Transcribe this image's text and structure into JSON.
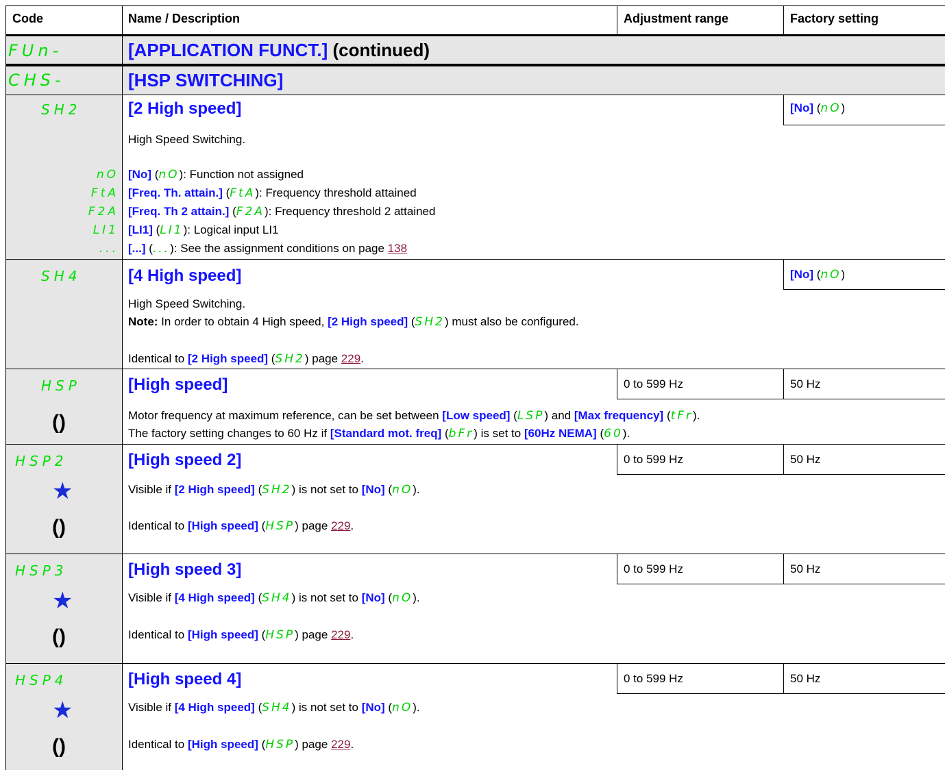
{
  "headers": {
    "code": "Code",
    "name": "Name / Description",
    "range": "Adjustment range",
    "factory": "Factory setting"
  },
  "fun": {
    "code": "FUn-",
    "title": "[APPLICATION FUNCT.]",
    "suffix": " (continued)"
  },
  "chs": {
    "code": "CHS-",
    "title": "[HSP SWITCHING]"
  },
  "sh2": {
    "code": "SH2",
    "title": "[2 High speed]",
    "factory_b": "[No]",
    "factory_g": "nO",
    "desc": "High Speed Switching.",
    "options": [
      {
        "code": "nO",
        "b": "[No]",
        "g": "nO",
        "t": ": Function not assigned"
      },
      {
        "code": "FtA",
        "b": "[Freq. Th. attain.]",
        "g": "FtA",
        "t": ": Frequency threshold attained"
      },
      {
        "code": "F2A",
        "b": "[Freq. Th 2 attain.]",
        "g": "F2A",
        "t": ": Frequency threshold 2 attained"
      },
      {
        "code": "LI1",
        "b": "[LI1]",
        "g": "LI1",
        "t": ": Logical input LI1"
      },
      {
        "code": "...",
        "b": "[...]",
        "g": "...",
        "t": ": See the assignment conditions on page ",
        "link": "138"
      }
    ]
  },
  "sh4": {
    "code": "SH4",
    "title": "[4 High speed]",
    "factory_b": "[No]",
    "factory_g": "nO",
    "desc": "High Speed Switching.",
    "note_label": "Note:",
    "note_a": " In order to obtain 4 High speed, ",
    "note_b": "[2 High speed]",
    "note_g": "SH2",
    "note_c": " must also be configured.",
    "ident_a": "Identical to ",
    "ident_b": "[2 High speed]",
    "ident_g": "SH2",
    "ident_c": " page ",
    "ident_link": "229",
    "ident_d": "."
  },
  "hsp": {
    "code": "HSP",
    "title": "[High speed]",
    "range": "0 to 599 Hz",
    "factory": "50 Hz",
    "l1_a": "Motor frequency at maximum reference, can be set between ",
    "l1_b": "[Low speed]",
    "l1_g": "LSP",
    "l1_c": " and ",
    "l1_d": "[Max frequency]",
    "l1_g2": "tFr",
    "l1_e": ".",
    "l2_a": "The factory setting changes to 60 Hz if ",
    "l2_b": "[Standard mot. freq]",
    "l2_g": "bFr",
    "l2_c": " is set to ",
    "l2_d": "[60Hz NEMA]",
    "l2_g2": "60",
    "l2_e": "."
  },
  "hsp2": {
    "code": "HSP2",
    "title": "[High speed 2]",
    "range": "0 to 599 Hz",
    "factory": "50 Hz",
    "v_a": "Visible if ",
    "v_b": "[2 High speed]",
    "v_g": "SH2",
    "v_c": " is not set to ",
    "v_d": "[No]",
    "v_g2": "nO",
    "v_e": ".",
    "i_a": "Identical to ",
    "i_b": "[High speed]",
    "i_g": "HSP",
    "i_c": " page ",
    "i_link": "229",
    "i_d": "."
  },
  "hsp3": {
    "code": "HSP3",
    "title": "[High speed 3]",
    "range": "0 to 599 Hz",
    "factory": "50 Hz",
    "v_a": "Visible if ",
    "v_b": "[4 High speed]",
    "v_g": "SH4",
    "v_c": " is not set to ",
    "v_d": "[No]",
    "v_g2": "nO",
    "v_e": ".",
    "i_a": "Identical to ",
    "i_b": "[High speed]",
    "i_g": "HSP",
    "i_c": " page ",
    "i_link": "229",
    "i_d": "."
  },
  "hsp4": {
    "code": "HSP4",
    "title": "[High speed 4]",
    "range": "0 to 599 Hz",
    "factory": "50 Hz",
    "v_a": "Visible if ",
    "v_b": "[4 High speed]",
    "v_g": "SH4",
    "v_c": " is not set to ",
    "v_d": "[No]",
    "v_g2": "nO",
    "v_e": ".",
    "i_a": "Identical to ",
    "i_b": "[High speed]",
    "i_g": "HSP",
    "i_c": " page ",
    "i_link": "229",
    "i_d": "."
  },
  "glyphs": {
    "lp": " (",
    "rp": ")",
    "cycle": "()",
    "star": "★"
  }
}
